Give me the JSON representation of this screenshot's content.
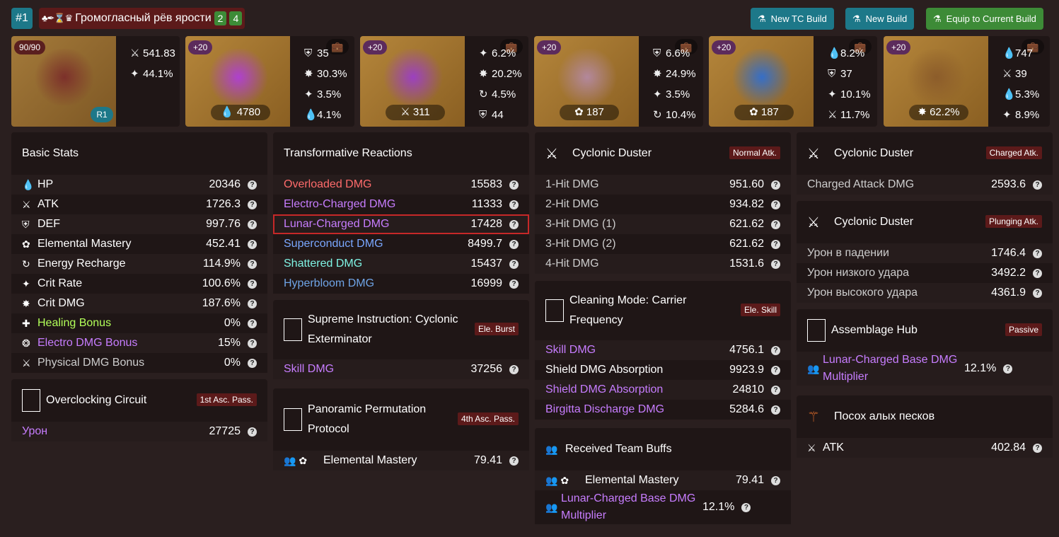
{
  "topbar": {
    "index": "#1",
    "set_icons": "♣✒⌛♛",
    "set_name": "Громогласный рёв ярости",
    "count_a": "2",
    "count_b": "4",
    "buttons": [
      "New TC Build",
      "New Build",
      "Equip to Current Build"
    ]
  },
  "cards": [
    {
      "level": "90/90",
      "refine": "R1",
      "subs": [
        [
          "⚔",
          "541.83"
        ],
        [
          "✦",
          "44.1%"
        ]
      ]
    },
    {
      "level": "+20",
      "main": "4780",
      "main_icon": "💧",
      "subs": [
        [
          "⛨",
          "35"
        ],
        [
          "✸",
          "30.3%"
        ],
        [
          "✦",
          "3.5%"
        ],
        [
          "💧",
          "4.1%"
        ]
      ]
    },
    {
      "level": "+20",
      "main": "311",
      "main_icon": "⚔",
      "subs": [
        [
          "✦",
          "6.2%"
        ],
        [
          "✸",
          "20.2%"
        ],
        [
          "↻",
          "4.5%"
        ],
        [
          "⛨",
          "44"
        ]
      ]
    },
    {
      "level": "+20",
      "main": "187",
      "main_icon": "✿",
      "subs": [
        [
          "⛨",
          "6.6%"
        ],
        [
          "✸",
          "24.9%"
        ],
        [
          "✦",
          "3.5%"
        ],
        [
          "↻",
          "10.4%"
        ]
      ]
    },
    {
      "level": "+20",
      "main": "187",
      "main_icon": "✿",
      "subs": [
        [
          "💧",
          "8.2%"
        ],
        [
          "⛨",
          "37"
        ],
        [
          "✦",
          "10.1%"
        ],
        [
          "⚔",
          "11.7%"
        ]
      ]
    },
    {
      "level": "+20",
      "main": "62.2%",
      "main_icon": "✸",
      "subs": [
        [
          "💧",
          "747"
        ],
        [
          "⚔",
          "39"
        ],
        [
          "💧",
          "5.3%"
        ],
        [
          "✦",
          "8.9%"
        ]
      ]
    }
  ],
  "basic": {
    "title": "Basic Stats",
    "rows": [
      [
        "💧",
        "HP",
        "20346",
        ""
      ],
      [
        "⚔",
        "ATK",
        "1726.3",
        ""
      ],
      [
        "⛨",
        "DEF",
        "997.76",
        ""
      ],
      [
        "✿",
        "Elemental Mastery",
        "452.41",
        ""
      ],
      [
        "↻",
        "Energy Recharge",
        "114.9%",
        ""
      ],
      [
        "✦",
        "Crit Rate",
        "100.6%",
        ""
      ],
      [
        "✸",
        "Crit DMG",
        "187.6%",
        ""
      ],
      [
        "✚",
        "Healing Bonus",
        "0%",
        "yg"
      ],
      [
        "❂",
        "Electro DMG Bonus",
        "15%",
        "pu"
      ],
      [
        "⚔",
        "Physical DMG Bonus",
        "0%",
        "gr"
      ]
    ]
  },
  "overclock": {
    "title": "Overclocking Circuit",
    "badge": "1st Asc. Pass.",
    "rows": [
      [
        "",
        "Урон",
        "27725",
        "pu"
      ]
    ]
  },
  "transform": {
    "title": "Transformative Reactions",
    "rows": [
      [
        "",
        "Overloaded DMG",
        "15583",
        "rd"
      ],
      [
        "",
        "Electro-Charged DMG",
        "11333",
        "pu"
      ],
      [
        "",
        "Lunar-Charged DMG",
        "17428",
        "pu"
      ],
      [
        "",
        "Superconduct DMG",
        "8499.7",
        "bl"
      ],
      [
        "",
        "Shattered DMG",
        "15437",
        "cy"
      ],
      [
        "",
        "Hyperbloom DMG",
        "16999",
        "blu"
      ]
    ]
  },
  "supreme": {
    "title": "Supreme Instruction: Cyclonic Exterminator",
    "badge": "Ele. Burst",
    "rows": [
      [
        "",
        "Skill DMG",
        "37256",
        "pu"
      ]
    ]
  },
  "panoramic": {
    "title": "Panoramic Permutation Protocol",
    "badge": "4th Asc. Pass.",
    "rows": [
      [
        "👥 ✿",
        "Elemental Mastery",
        "79.41",
        ""
      ]
    ]
  },
  "cyclonic_normal": {
    "title": "Cyclonic Duster",
    "badge": "Normal Atk.",
    "rows": [
      [
        "",
        "1-Hit DMG",
        "951.60",
        "gr"
      ],
      [
        "",
        "2-Hit DMG",
        "934.82",
        "gr"
      ],
      [
        "",
        "3-Hit DMG (1)",
        "621.62",
        "gr"
      ],
      [
        "",
        "3-Hit DMG (2)",
        "621.62",
        "gr"
      ],
      [
        "",
        "4-Hit DMG",
        "1531.6",
        "gr"
      ]
    ]
  },
  "cleaning": {
    "title": "Cleaning Mode: Carrier Frequency",
    "badge": "Ele. Skill",
    "rows": [
      [
        "",
        "Skill DMG",
        "4756.1",
        "pu"
      ],
      [
        "",
        "Shield DMG Absorption",
        "9923.9",
        ""
      ],
      [
        "",
        "Shield DMG Absorption",
        "24810",
        "pu"
      ],
      [
        "",
        "Birgitta Discharge DMG",
        "5284.6",
        "pu"
      ]
    ]
  },
  "received": {
    "title": "Received Team Buffs",
    "rows": [
      [
        "👥 ✿",
        "Elemental Mastery",
        "79.41",
        ""
      ],
      [
        "👥",
        "Lunar-Charged Base DMG Multiplier",
        "12.1%",
        "pu"
      ]
    ]
  },
  "cyclonic_charged": {
    "title": "Cyclonic Duster",
    "badge": "Charged Atk.",
    "rows": [
      [
        "",
        "Charged Attack DMG",
        "2593.6",
        "gr"
      ]
    ]
  },
  "cyclonic_plunge": {
    "title": "Cyclonic Duster",
    "badge": "Plunging Atk.",
    "rows": [
      [
        "",
        "Урон в падении",
        "1746.4",
        "gr"
      ],
      [
        "",
        "Урон низкого удара",
        "3492.2",
        "gr"
      ],
      [
        "",
        "Урон высокого удара",
        "4361.9",
        "gr"
      ]
    ]
  },
  "assemblage": {
    "title": "Assemblage Hub",
    "badge": "Passive",
    "rows": [
      [
        "👥",
        "Lunar-Charged Base DMG Multiplier",
        "12.1%",
        "pu"
      ]
    ]
  },
  "weapon_panel": {
    "title": "Посох алых песков",
    "rows": [
      [
        "⚔",
        "ATK",
        "402.84",
        ""
      ]
    ]
  }
}
